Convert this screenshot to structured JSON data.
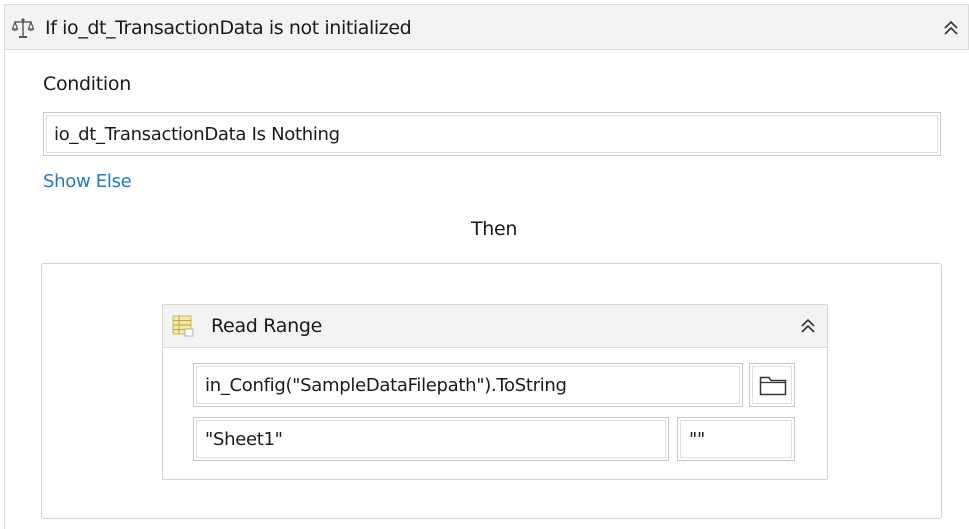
{
  "if_activity": {
    "title": "If io_dt_TransactionData is not initialized",
    "icon": "if-scale-icon",
    "collapse_icon": "double-chevron-up-icon"
  },
  "condition": {
    "label": "Condition",
    "value": "io_dt_TransactionData Is Nothing"
  },
  "show_else_label": "Show Else",
  "then_label": "Then",
  "read_range": {
    "title": "Read Range",
    "icon": "excel-sheet-icon",
    "collapse_icon": "double-chevron-up-icon",
    "workbook_path": "in_Config(\"SampleDataFilepath\").ToString",
    "browse_icon": "folder-icon",
    "sheet_name": "\"Sheet1\"",
    "range": "\"\""
  }
}
